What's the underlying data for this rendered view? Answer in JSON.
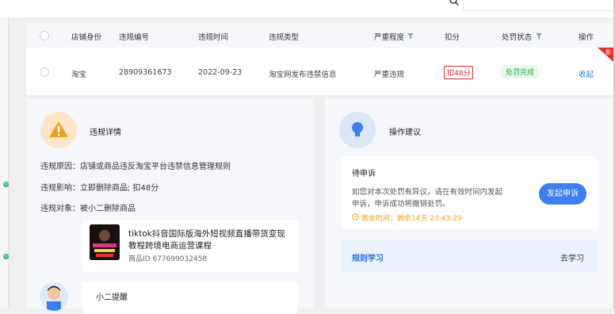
{
  "table": {
    "headers": {
      "shop_identity": "店铺身份",
      "violation_no": "违规编号",
      "violation_time": "违规时间",
      "violation_type": "违规类型",
      "severity": "严重程度",
      "deduction": "扣分",
      "penalty_status": "处罚状态",
      "action": "操作"
    },
    "row": {
      "shop_identity": "淘宝",
      "violation_no": "28909361673",
      "violation_time": "2022-09-23",
      "violation_type": "淘宝网发布违禁信息",
      "severity": "严重违规",
      "deduction": "扣48分",
      "penalty_status": "处罚完成",
      "action": "收起",
      "corner_tag": "新"
    }
  },
  "details": {
    "title": "违规详情",
    "reason": "违规原因：店铺或商品违反淘宝平台违禁信息管理规则",
    "impact": "违规影响：立即删除商品; 扣48分",
    "target": "违规对象：被小二删除商品",
    "product": {
      "title_line1": "tiktok抖音国际版海外短视频直播带货变现",
      "title_line2": "教程跨境电商运营课程",
      "id": "商品ID 677699032458"
    },
    "remind_title": "小二提醒"
  },
  "advice": {
    "title": "操作建议",
    "appeal_title": "待申诉",
    "appeal_desc_line1": "如您对本次处罚有异议，请在有效时间内发起",
    "appeal_desc_line2": "申诉，申诉成功将撤销处罚。",
    "countdown": "剩余时间：剩余14天 23:43:29",
    "appeal_button": "发起申诉",
    "rules_title": "规则学习",
    "rules_link": "去学习"
  },
  "colors": {
    "accent_blue": "#3d7ef0",
    "danger_red": "#e0242b",
    "success_green": "#28a745",
    "warning_orange": "#f0a020"
  }
}
